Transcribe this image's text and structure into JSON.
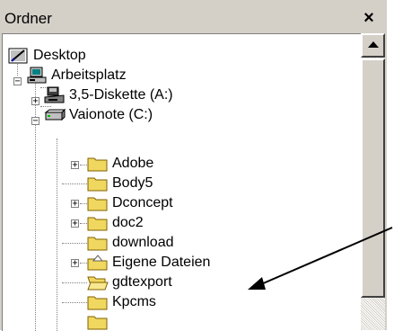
{
  "header": {
    "title": "Ordner",
    "close_label": "×"
  },
  "tree": {
    "root": {
      "label": "Desktop",
      "icon": "desktop-icon"
    },
    "computer": {
      "label": "Arbeitsplatz",
      "icon": "computer-icon"
    },
    "drives": [
      {
        "label": "3,5-Diskette (A:)",
        "icon": "floppy-drive-icon"
      },
      {
        "label": "Vaionote (C:)",
        "icon": "hard-drive-icon"
      }
    ],
    "folders": [
      {
        "label": "Adobe",
        "expandable": true
      },
      {
        "label": "Body5",
        "expandable": false
      },
      {
        "label": "Dconcept",
        "expandable": true
      },
      {
        "label": "doc2",
        "expandable": true
      },
      {
        "label": "download",
        "expandable": false
      },
      {
        "label": "Eigene Dateien",
        "expandable": true
      },
      {
        "label": "gdtexport",
        "expandable": false
      },
      {
        "label": "Kpcms",
        "expandable": false
      }
    ]
  },
  "colors": {
    "window_bg": "#d4d0c8",
    "tree_bg": "#ffffff",
    "folder_yellow": "#f0d860",
    "arrow": "#000000"
  }
}
